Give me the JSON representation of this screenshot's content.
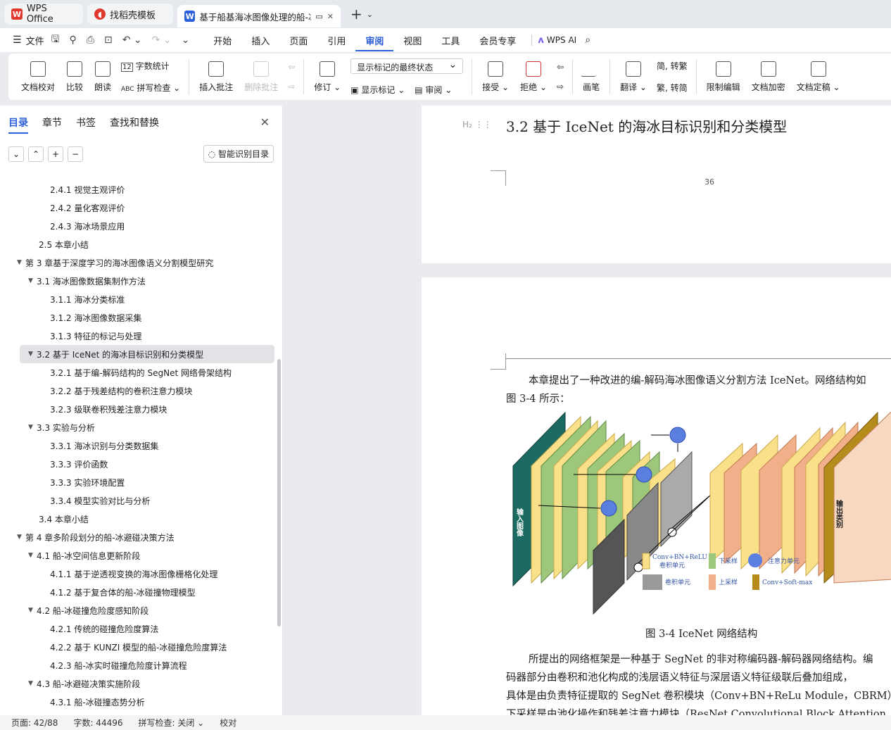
{
  "tabs": {
    "app": "WPS Office",
    "template": "找稻壳模板",
    "doc": "基于船基海冰图像处理的船-冰"
  },
  "menu": {
    "file": "文件",
    "items": [
      "开始",
      "插入",
      "页面",
      "引用",
      "审阅",
      "视图",
      "工具",
      "会员专享"
    ],
    "ai": "WPS AI"
  },
  "ribbon": {
    "proofread": "文档校对",
    "compare": "比较",
    "read": "朗读",
    "wordcount": "字数统计",
    "spellcheck": "拼写检查",
    "insert_comment": "插入批注",
    "delete_comment": "删除批注",
    "revise": "修订",
    "markup_state": "显示标记的最终状态",
    "show_markup": "显示标记",
    "review": "审阅",
    "accept": "接受",
    "reject": "拒绝",
    "pen": "画笔",
    "translate": "翻译",
    "to_trad": "简, 转繁",
    "to_simp": "繁, 转简",
    "restrict": "限制编辑",
    "encrypt": "文档加密",
    "finalize": "文档定稿"
  },
  "sidebar": {
    "tabs": [
      "目录",
      "章节",
      "书签",
      "查找和替换"
    ],
    "smart": "智能识别目录",
    "toc": [
      {
        "level": 3,
        "text": "2.4.1  视觉主观评价"
      },
      {
        "level": 3,
        "text": "2.4.2  量化客观评价"
      },
      {
        "level": 3,
        "text": "2.4.3  海冰场景应用"
      },
      {
        "level": 2,
        "text": "2.5  本章小结"
      },
      {
        "level": 1,
        "caret": true,
        "text": "第 3 章基于深度学习的海冰图像语义分割模型研究"
      },
      {
        "level": 2,
        "caret": true,
        "text": "3.1  海冰图像数据集制作方法"
      },
      {
        "level": 3,
        "text": "3.1.1  海冰分类标准"
      },
      {
        "level": 3,
        "text": "3.1.2  海冰图像数据采集"
      },
      {
        "level": 3,
        "text": "3.1.3  特征的标记与处理"
      },
      {
        "level": 2,
        "caret": true,
        "selected": true,
        "text": "3.2  基于 IceNet 的海冰目标识别和分类模型"
      },
      {
        "level": 3,
        "text": "3.2.1  基于编-解码结构的 SegNet 网络骨架结构"
      },
      {
        "level": 3,
        "text": "3.2.2  基于残差结构的卷积注意力模块"
      },
      {
        "level": 3,
        "text": "3.2.3  级联卷积残差注意力模块"
      },
      {
        "level": 2,
        "caret": true,
        "text": "3.3  实验与分析"
      },
      {
        "level": 3,
        "text": "3.3.1  海冰识别与分类数据集"
      },
      {
        "level": 3,
        "text": "3.3.3  评价函数"
      },
      {
        "level": 3,
        "text": "3.3.3  实验环境配置"
      },
      {
        "level": 3,
        "text": "3.3.4  模型实验对比与分析"
      },
      {
        "level": 2,
        "text": "3.4  本章小结"
      },
      {
        "level": 1,
        "caret": true,
        "text": "第 4 章多阶段划分的船-冰避碰决策方法"
      },
      {
        "level": 2,
        "caret": true,
        "text": "4.1  船-冰空间信息更新阶段"
      },
      {
        "level": 3,
        "text": "4.1.1  基于逆透视变换的海冰图像栅格化处理"
      },
      {
        "level": 3,
        "text": "4.1.2  基于复合体的船-冰碰撞物理模型"
      },
      {
        "level": 2,
        "caret": true,
        "text": "4.2  船-冰碰撞危险度感知阶段"
      },
      {
        "level": 3,
        "text": "4.2.1  传统的碰撞危险度算法"
      },
      {
        "level": 3,
        "text": "4.2.2  基于 KUNZI 模型的船-冰碰撞危险度算法"
      },
      {
        "level": 3,
        "text": "4.2.3  船-冰实时碰撞危险度计算流程"
      },
      {
        "level": 2,
        "caret": true,
        "text": "4.3  船-冰避碰决策实施阶段"
      },
      {
        "level": 3,
        "text": "4.3.1  船-冰碰撞态势分析"
      }
    ]
  },
  "document": {
    "heading_mark": "H₂",
    "heading": "3.2  基于 IceNet 的海冰目标识别和分类模型",
    "page_number": "36",
    "para1": [
      "本章提出了一种改进的编-解码海冰图像语义分割方法 IceNet。网络结构如",
      "图 3-4 所示："
    ],
    "figure_caption": "图 3-4 IceNet 网络结构",
    "figure": {
      "input_label": "输入图像",
      "output_label": "输出类别",
      "legend": [
        "Conv+BN+ReLU",
        "卷积单元",
        "下采样",
        "注意力单元",
        "卷积单元",
        "上采样",
        "Conv+Soft-max"
      ]
    },
    "para2": [
      "所提出的网络框架是一种基于 SegNet 的非对称编码器-解码器网络结构。编",
      "码器部分由卷积和池化构成的浅层语义特征与深层语义特征级联后叠加组成，",
      "具体是由负责特征提取的 SegNet 卷积模块（Conv+BN+ReLu Module，CBRM）",
      "下采样是由池化操作和残差注意力模块（ResNet Convolutional Block Attention"
    ]
  },
  "status": {
    "page": "页面: 42/88",
    "words": "字数: 44496",
    "spell": "拼写检查: 关闭",
    "proof": "校对"
  },
  "colors": {
    "accent": "#2b5fd9",
    "input_block": "#1c6b63",
    "yellow": "#fbe08a",
    "green": "#9dc77a",
    "orange": "#f2b08a",
    "output_block": "#b58b1c"
  }
}
